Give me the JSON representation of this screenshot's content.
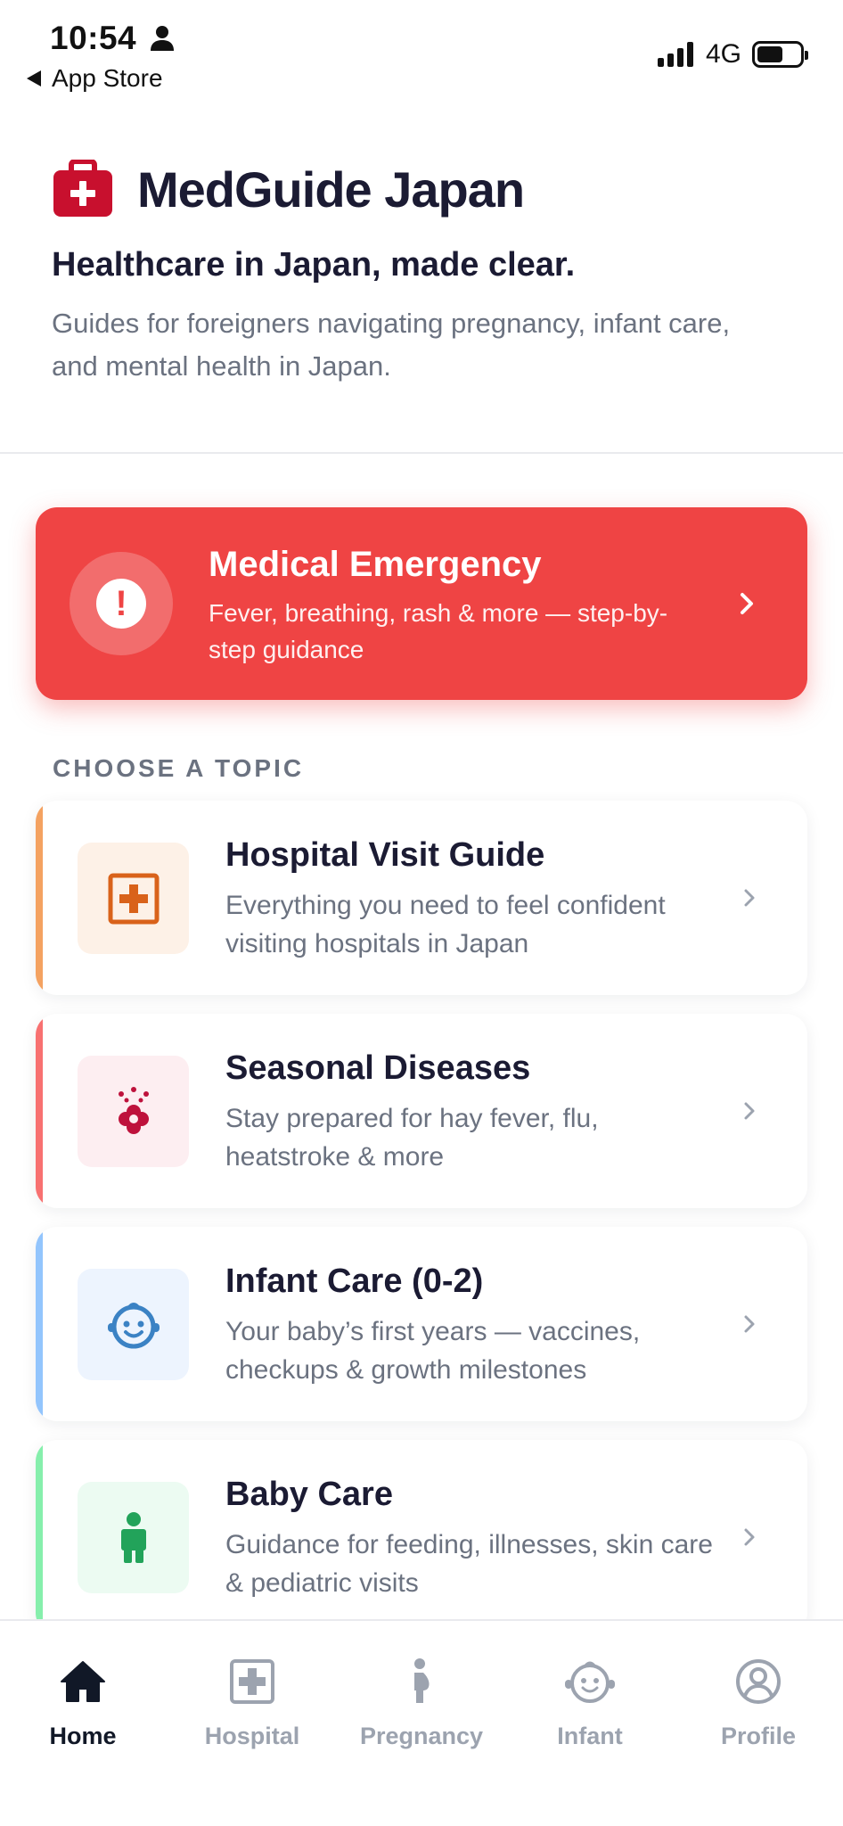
{
  "status_bar": {
    "time": "10:54",
    "back_label": "App Store",
    "network": "4G"
  },
  "header": {
    "app_title": "MedGuide Japan",
    "tagline": "Healthcare in Japan, made clear.",
    "description": "Guides for foreigners navigating pregnancy, infant care, and mental health in Japan."
  },
  "emergency": {
    "title": "Medical Emergency",
    "subtitle": "Fever, breathing, rash & more — step-by-step guidance",
    "icon": "alert-icon",
    "color": "#ef4444"
  },
  "topics_section": {
    "label": "CHOOSE A TOPIC",
    "items": [
      {
        "title": "Hospital Visit Guide",
        "description": "Everything you need to feel confident visiting hospitals in Japan",
        "icon": "hospital-icon",
        "accent": "#f4a261"
      },
      {
        "title": "Seasonal Diseases",
        "description": "Stay prepared for hay fever, flu, heatstroke & more",
        "icon": "pollen-flower-icon",
        "accent": "#f87171"
      },
      {
        "title": "Infant Care (0-2)",
        "description": "Your baby’s first years — vaccines, checkups & growth milestones",
        "icon": "baby-face-icon",
        "accent": "#93c5fd"
      },
      {
        "title": "Baby Care",
        "description": "Guidance for feeding, illnesses, skin care & pediatric visits",
        "icon": "child-icon",
        "accent": "#86efac"
      }
    ]
  },
  "tab_bar": {
    "tabs": [
      {
        "label": "Home",
        "icon": "home-icon",
        "active": true
      },
      {
        "label": "Hospital",
        "icon": "hospital-cross-icon",
        "active": false
      },
      {
        "label": "Pregnancy",
        "icon": "pregnancy-icon",
        "active": false
      },
      {
        "label": "Infant",
        "icon": "baby-face-icon",
        "active": false
      },
      {
        "label": "Profile",
        "icon": "profile-icon",
        "active": false
      }
    ]
  }
}
